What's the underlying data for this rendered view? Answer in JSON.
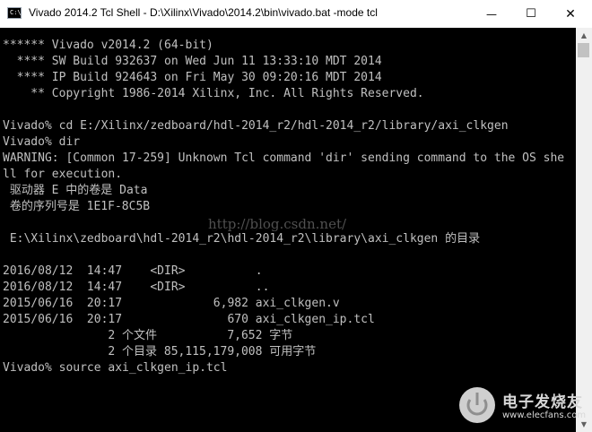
{
  "window": {
    "icon_text": "C:\\",
    "title": "Vivado 2014.2 Tcl Shell - D:\\Xilinx\\Vivado\\2014.2\\bin\\vivado.bat  -mode tcl",
    "minimize_glyph": "—",
    "maximize_glyph": "☐",
    "close_glyph": "✕"
  },
  "console": {
    "lines": [
      "****** Vivado v2014.2 (64-bit)",
      "  **** SW Build 932637 on Wed Jun 11 13:33:10 MDT 2014",
      "  **** IP Build 924643 on Fri May 30 09:20:16 MDT 2014",
      "    ** Copyright 1986-2014 Xilinx, Inc. All Rights Reserved.",
      "",
      "Vivado% cd E:/Xilinx/zedboard/hdl-2014_r2/hdl-2014_r2/library/axi_clkgen",
      "Vivado% dir",
      "WARNING: [Common 17-259] Unknown Tcl command 'dir' sending command to the OS she",
      "ll for execution.",
      " 驱动器 E 中的卷是 Data",
      " 卷的序列号是 1E1F-8C5B",
      "",
      " E:\\Xilinx\\zedboard\\hdl-2014_r2\\hdl-2014_r2\\library\\axi_clkgen 的目录",
      "",
      "2016/08/12  14:47    <DIR>          .",
      "2016/08/12  14:47    <DIR>          ..",
      "2015/06/16  20:17             6,982 axi_clkgen.v",
      "2015/06/16  20:17               670 axi_clkgen_ip.tcl",
      "               2 个文件          7,652 字节",
      "               2 个目录 85,115,179,008 可用字节",
      "Vivado% source axi_clkgen_ip.tcl"
    ]
  },
  "scrollbar": {
    "up_glyph": "▲",
    "down_glyph": "▼"
  },
  "watermark": {
    "text": "http://blog.csdn.net/"
  },
  "logo": {
    "name": "电子发烧友",
    "url": "www.elecfans.com"
  }
}
